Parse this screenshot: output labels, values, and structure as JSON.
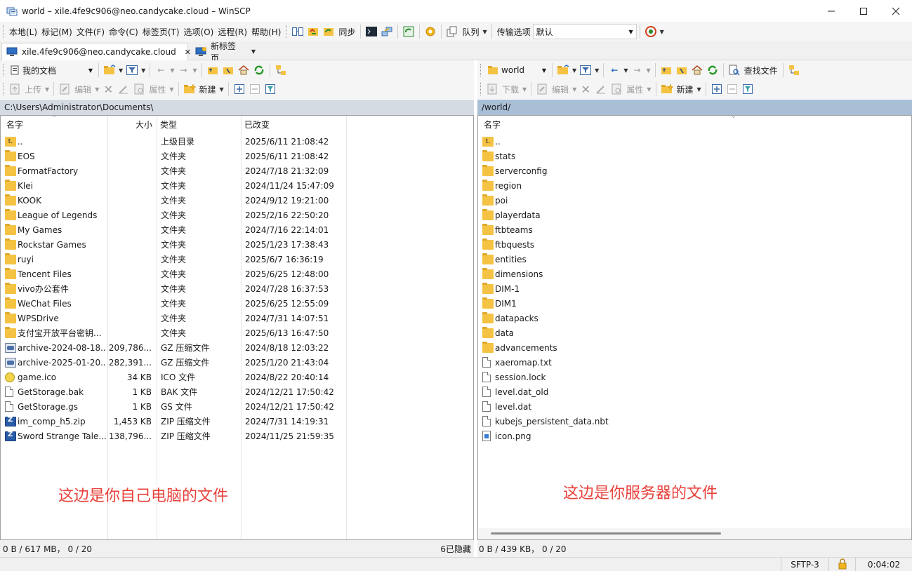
{
  "window": {
    "title": "world – xile.4fe9c906@neo.candycake.cloud – WinSCP",
    "minimize_label": "—",
    "maximize_label": "☐",
    "close_label": "✕"
  },
  "menu": {
    "items": [
      "本地(L)",
      "标记(M)",
      "文件(F)",
      "命令(C)",
      "标签页(T)",
      "选项(O)",
      "远程(R)",
      "帮助(H)"
    ],
    "sync_label": "同步",
    "queue_label": "队列",
    "transfer_options_label": "传输选项",
    "transfer_preset": "默认"
  },
  "tabs": {
    "session_tab": "xile.4fe9c906@neo.candycake.cloud",
    "new_tab": "新标签页",
    "close_glyph": "✕"
  },
  "left": {
    "location_combo": "我的文档",
    "upload_label": "上传",
    "edit_label": "编辑",
    "properties_label": "属性",
    "new_label": "新建",
    "path": "C:\\Users\\Administrator\\Documents\\",
    "columns": [
      "名字",
      "大小",
      "类型",
      "已改变"
    ],
    "rows": [
      {
        "icon": "parent-dir",
        "name": "..",
        "size": "",
        "type": "上级目录",
        "changed": "2025/6/11 21:08:42"
      },
      {
        "icon": "folder",
        "name": "EOS",
        "size": "",
        "type": "文件夹",
        "changed": "2025/6/11 21:08:42"
      },
      {
        "icon": "folder",
        "name": "FormatFactory",
        "size": "",
        "type": "文件夹",
        "changed": "2024/7/18 21:32:09"
      },
      {
        "icon": "folder",
        "name": "Klei",
        "size": "",
        "type": "文件夹",
        "changed": "2024/11/24 15:47:09"
      },
      {
        "icon": "folder",
        "name": "KOOK",
        "size": "",
        "type": "文件夹",
        "changed": "2024/9/12 19:21:00"
      },
      {
        "icon": "folder",
        "name": "League of Legends",
        "size": "",
        "type": "文件夹",
        "changed": "2025/2/16 22:50:20"
      },
      {
        "icon": "folder",
        "name": "My Games",
        "size": "",
        "type": "文件夹",
        "changed": "2024/7/16 22:14:01"
      },
      {
        "icon": "folder",
        "name": "Rockstar Games",
        "size": "",
        "type": "文件夹",
        "changed": "2025/1/23 17:38:43"
      },
      {
        "icon": "folder",
        "name": "ruyi",
        "size": "",
        "type": "文件夹",
        "changed": "2025/6/7 16:36:19"
      },
      {
        "icon": "folder",
        "name": "Tencent Files",
        "size": "",
        "type": "文件夹",
        "changed": "2025/6/25 12:48:00"
      },
      {
        "icon": "folder",
        "name": "vivo办公套件",
        "size": "",
        "type": "文件夹",
        "changed": "2024/7/28 16:37:53"
      },
      {
        "icon": "folder",
        "name": "WeChat Files",
        "size": "",
        "type": "文件夹",
        "changed": "2025/6/25 12:55:09"
      },
      {
        "icon": "folder",
        "name": "WPSDrive",
        "size": "",
        "type": "文件夹",
        "changed": "2024/7/31 14:07:51"
      },
      {
        "icon": "folder",
        "name": "支付宝开放平台密钥...",
        "size": "",
        "type": "文件夹",
        "changed": "2025/6/13 16:47:50"
      },
      {
        "icon": "archive",
        "name": "archive-2024-08-18...",
        "size": "209,786...",
        "type": "GZ 压缩文件",
        "changed": "2024/8/18 12:03:22"
      },
      {
        "icon": "archive",
        "name": "archive-2025-01-20...",
        "size": "282,391...",
        "type": "GZ 压缩文件",
        "changed": "2025/1/20 21:43:04"
      },
      {
        "icon": "ico",
        "name": "game.ico",
        "size": "34 KB",
        "type": "ICO 文件",
        "changed": "2024/8/22 20:40:14"
      },
      {
        "icon": "file",
        "name": "GetStorage.bak",
        "size": "1 KB",
        "type": "BAK 文件",
        "changed": "2024/12/21 17:50:42"
      },
      {
        "icon": "file",
        "name": "GetStorage.gs",
        "size": "1 KB",
        "type": "GS 文件",
        "changed": "2024/12/21 17:50:42"
      },
      {
        "icon": "zip",
        "name": "im_comp_h5.zip",
        "size": "1,453 KB",
        "type": "ZIP 压缩文件",
        "changed": "2024/7/31 14:19:31"
      },
      {
        "icon": "zip",
        "name": "Sword Strange Tale...",
        "size": "138,796...",
        "type": "ZIP 压缩文件",
        "changed": "2024/11/25 21:59:35"
      }
    ],
    "annotation": "这边是你自己电脑的文件",
    "status": "0 B / 617 MB， 0 / 20",
    "hidden": "6已隐藏"
  },
  "right": {
    "location_combo": "world",
    "download_label": "下载",
    "edit_label": "编辑",
    "properties_label": "属性",
    "new_label": "新建",
    "find_files_label": "查找文件",
    "path": "/world/",
    "columns": [
      "名字"
    ],
    "rows": [
      {
        "icon": "parent-dir",
        "name": ".."
      },
      {
        "icon": "folder",
        "name": "stats"
      },
      {
        "icon": "folder",
        "name": "serverconfig"
      },
      {
        "icon": "folder",
        "name": "region"
      },
      {
        "icon": "folder",
        "name": "poi"
      },
      {
        "icon": "folder",
        "name": "playerdata"
      },
      {
        "icon": "folder",
        "name": "ftbteams"
      },
      {
        "icon": "folder",
        "name": "ftbquests"
      },
      {
        "icon": "folder",
        "name": "entities"
      },
      {
        "icon": "folder",
        "name": "dimensions"
      },
      {
        "icon": "folder",
        "name": "DIM-1"
      },
      {
        "icon": "folder",
        "name": "DIM1"
      },
      {
        "icon": "folder",
        "name": "datapacks"
      },
      {
        "icon": "folder",
        "name": "data"
      },
      {
        "icon": "folder",
        "name": "advancements"
      },
      {
        "icon": "file",
        "name": "xaeromap.txt"
      },
      {
        "icon": "file",
        "name": "session.lock"
      },
      {
        "icon": "file",
        "name": "level.dat_old"
      },
      {
        "icon": "file",
        "name": "level.dat"
      },
      {
        "icon": "file",
        "name": "kubejs_persistent_data.nbt"
      },
      {
        "icon": "png",
        "name": "icon.png"
      }
    ],
    "annotation": "这边是你服务器的文件",
    "status": "0 B / 439 KB， 0 / 20"
  },
  "statusbar": {
    "protocol": "SFTP-3",
    "elapsed": "0:04:02"
  },
  "colors": {
    "left_path_bg": "#d5dbe3",
    "right_path_bg": "#a9bfd6",
    "annotation": "#e8413b",
    "folder": "#f5c343"
  }
}
